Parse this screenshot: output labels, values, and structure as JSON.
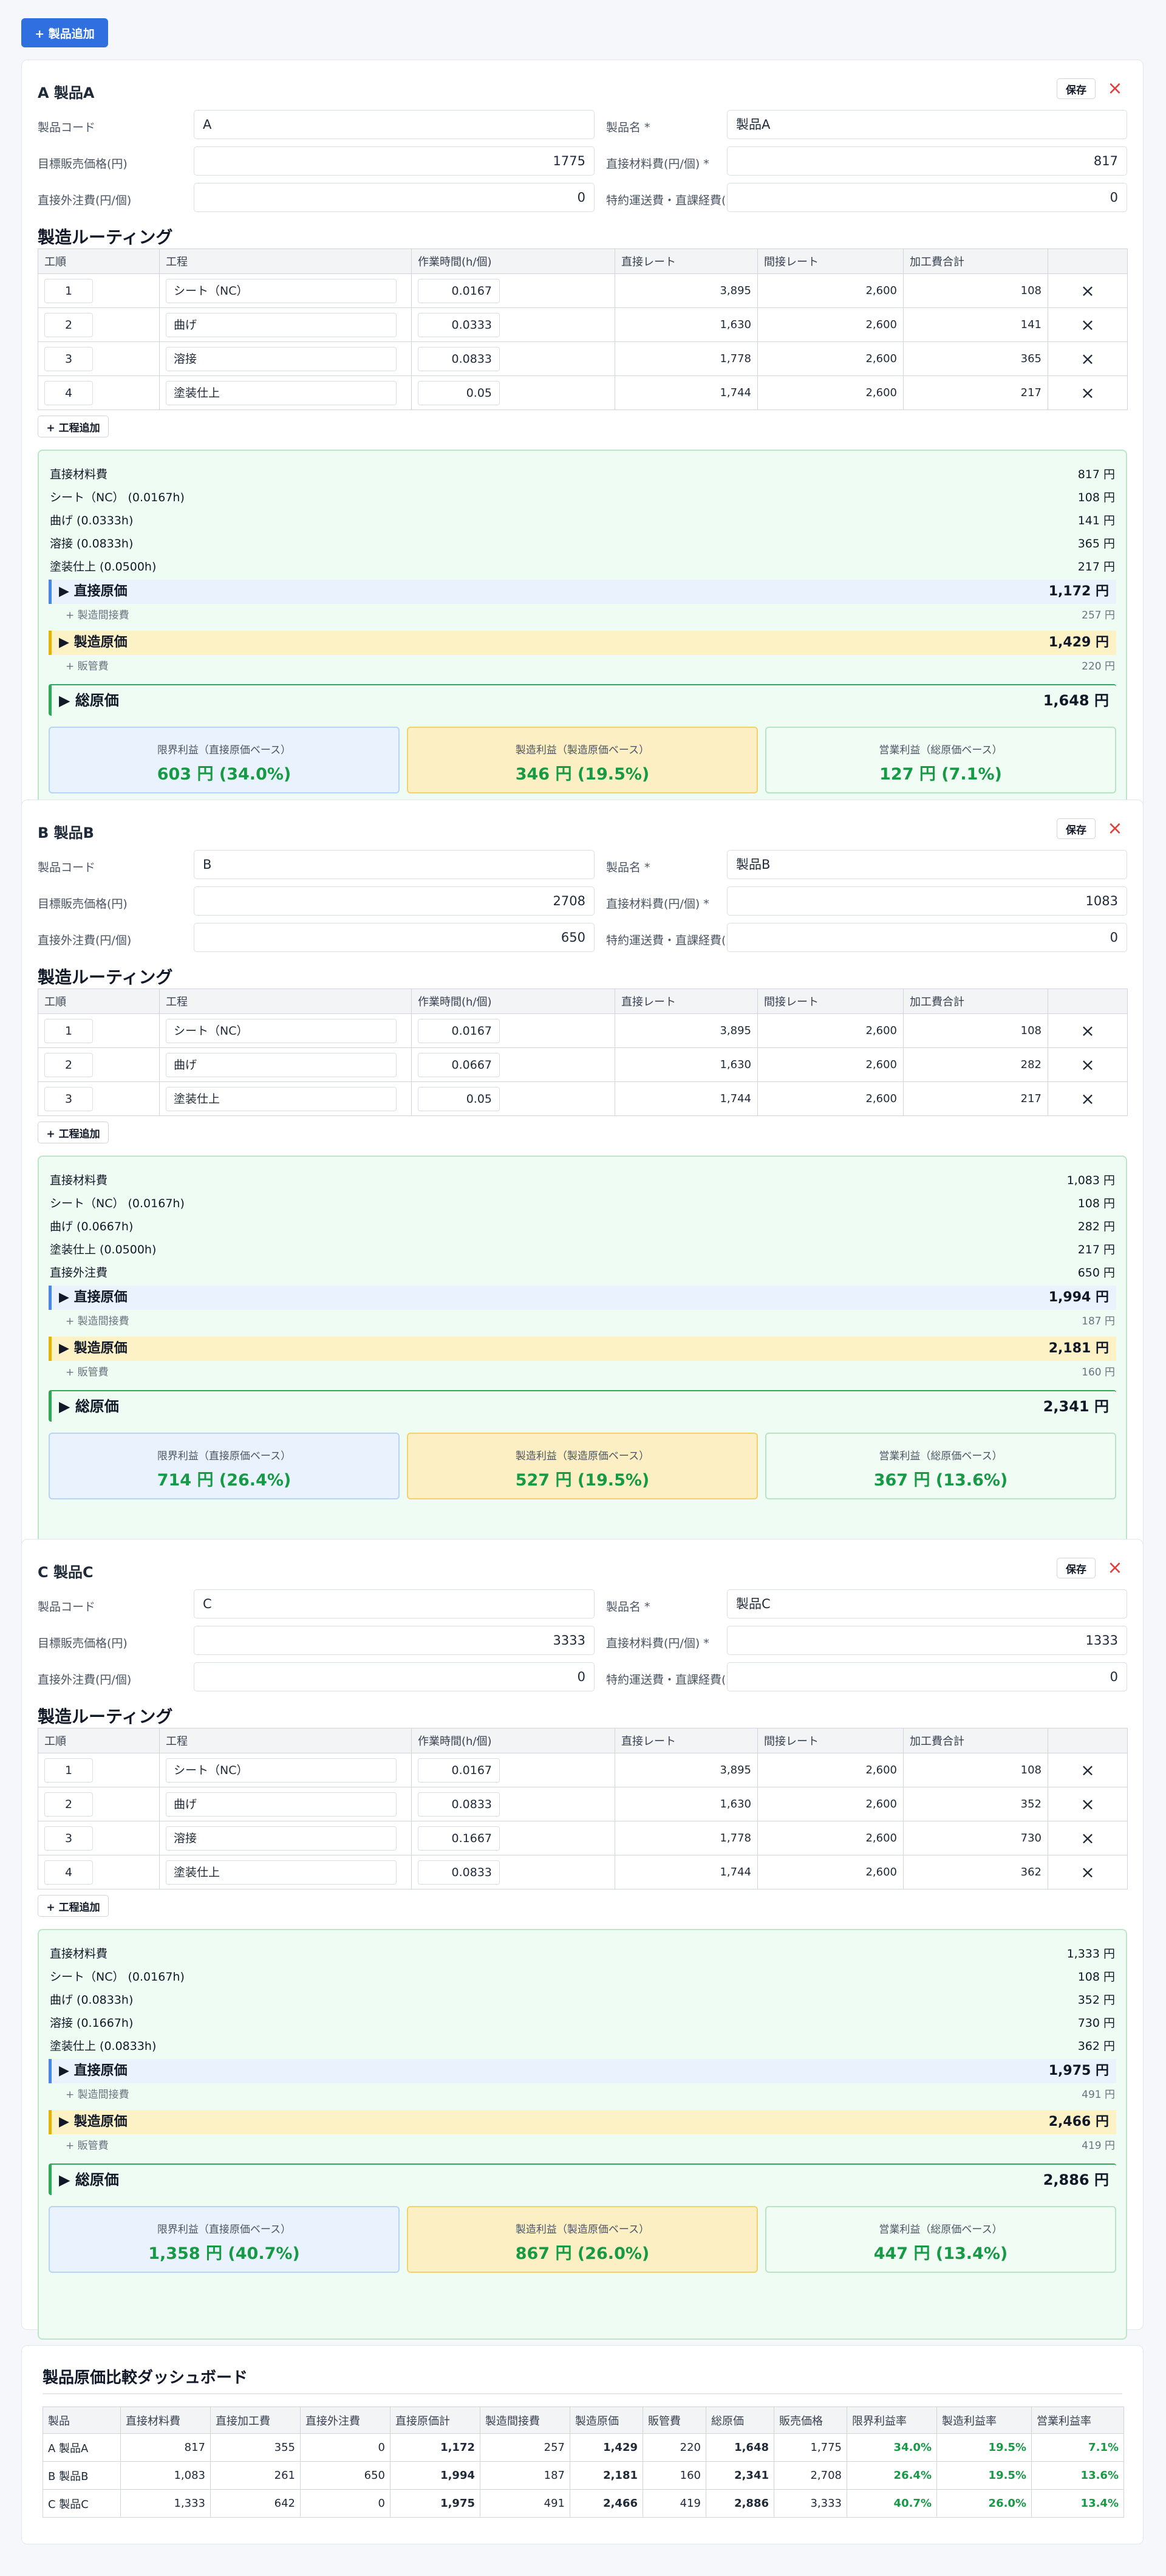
{
  "add_product_label": "+ 製品追加",
  "save_label": "保存",
  "delete_icon": "×",
  "field_labels": {
    "code": "製品コード",
    "name": "製品名 *",
    "target_price": "目標販売価格(円)",
    "material": "直接材料費(円/個) *",
    "outsource": "直接外注費(円/個)",
    "special": "特約運送費・直課経費("
  },
  "routing_title": "製造ルーティング",
  "routing_headers": [
    "工順",
    "工程",
    "作業時間(h/個)",
    "直接レート",
    "間接レート",
    "加工費合計",
    ""
  ],
  "add_process_label": "+ 工程追加",
  "summary_labels": {
    "material": "直接材料費",
    "outsource": "直接外注費",
    "direct_cost": "▶ 直接原価",
    "mfg_indirect": "+ 製造間接費",
    "mfg_cost": "▶ 製造原価",
    "sga": "+ 販管費",
    "total_cost": "▶ 総原価",
    "box1": "限界利益（直接原価ベース）",
    "box2": "製造利益（製造原価ベース）",
    "box3": "営業利益（総原価ベース）"
  },
  "products": [
    {
      "title": "A 製品A",
      "code": "A",
      "name": "製品A",
      "target_price": "1775",
      "material": "817",
      "outsource": "0",
      "special": "0",
      "routing": [
        {
          "seq": "1",
          "process": "シート（NC）",
          "time": "0.0167",
          "direct": "3,895",
          "indirect": "2,600",
          "total": "108"
        },
        {
          "seq": "2",
          "process": "曲げ",
          "time": "0.0333",
          "direct": "1,630",
          "indirect": "2,600",
          "total": "141"
        },
        {
          "seq": "3",
          "process": "溶接",
          "time": "0.0833",
          "direct": "1,778",
          "indirect": "2,600",
          "total": "365"
        },
        {
          "seq": "4",
          "process": "塗装仕上",
          "time": "0.05",
          "direct": "1,744",
          "indirect": "2,600",
          "total": "217"
        }
      ],
      "summary": {
        "material": "817 円",
        "lines": [
          {
            "label": "シート（NC） (0.0167h)",
            "value": "108 円"
          },
          {
            "label": "曲げ (0.0333h)",
            "value": "141 円"
          },
          {
            "label": "溶接 (0.0833h)",
            "value": "365 円"
          },
          {
            "label": "塗装仕上 (0.0500h)",
            "value": "217 円"
          }
        ],
        "outsource": null,
        "direct_cost": "1,172 円",
        "mfg_indirect": "257 円",
        "mfg_cost": "1,429 円",
        "sga": "220 円",
        "total_cost": "1,648 円",
        "box1": "603 円 (34.0%)",
        "box2": "346 円 (19.5%)",
        "box3": "127 円 (7.1%)"
      }
    },
    {
      "title": "B 製品B",
      "code": "B",
      "name": "製品B",
      "target_price": "2708",
      "material": "1083",
      "outsource": "650",
      "special": "0",
      "routing": [
        {
          "seq": "1",
          "process": "シート（NC）",
          "time": "0.0167",
          "direct": "3,895",
          "indirect": "2,600",
          "total": "108"
        },
        {
          "seq": "2",
          "process": "曲げ",
          "time": "0.0667",
          "direct": "1,630",
          "indirect": "2,600",
          "total": "282"
        },
        {
          "seq": "3",
          "process": "塗装仕上",
          "time": "0.05",
          "direct": "1,744",
          "indirect": "2,600",
          "total": "217"
        }
      ],
      "summary": {
        "material": "1,083 円",
        "lines": [
          {
            "label": "シート（NC） (0.0167h)",
            "value": "108 円"
          },
          {
            "label": "曲げ (0.0667h)",
            "value": "282 円"
          },
          {
            "label": "塗装仕上 (0.0500h)",
            "value": "217 円"
          }
        ],
        "outsource": "650 円",
        "direct_cost": "1,994 円",
        "mfg_indirect": "187 円",
        "mfg_cost": "2,181 円",
        "sga": "160 円",
        "total_cost": "2,341 円",
        "box1": "714 円 (26.4%)",
        "box2": "527 円 (19.5%)",
        "box3": "367 円 (13.6%)"
      }
    },
    {
      "title": "C 製品C",
      "code": "C",
      "name": "製品C",
      "target_price": "3333",
      "material": "1333",
      "outsource": "0",
      "special": "0",
      "routing": [
        {
          "seq": "1",
          "process": "シート（NC）",
          "time": "0.0167",
          "direct": "3,895",
          "indirect": "2,600",
          "total": "108"
        },
        {
          "seq": "2",
          "process": "曲げ",
          "time": "0.0833",
          "direct": "1,630",
          "indirect": "2,600",
          "total": "352"
        },
        {
          "seq": "3",
          "process": "溶接",
          "time": "0.1667",
          "direct": "1,778",
          "indirect": "2,600",
          "total": "730"
        },
        {
          "seq": "4",
          "process": "塗装仕上",
          "time": "0.0833",
          "direct": "1,744",
          "indirect": "2,600",
          "total": "362"
        }
      ],
      "summary": {
        "material": "1,333 円",
        "lines": [
          {
            "label": "シート（NC） (0.0167h)",
            "value": "108 円"
          },
          {
            "label": "曲げ (0.0833h)",
            "value": "352 円"
          },
          {
            "label": "溶接 (0.1667h)",
            "value": "730 円"
          },
          {
            "label": "塗装仕上 (0.0833h)",
            "value": "362 円"
          }
        ],
        "outsource": null,
        "direct_cost": "1,975 円",
        "mfg_indirect": "491 円",
        "mfg_cost": "2,466 円",
        "sga": "419 円",
        "total_cost": "2,886 円",
        "box1": "1,358 円 (40.7%)",
        "box2": "867 円 (26.0%)",
        "box3": "447 円 (13.4%)"
      }
    }
  ],
  "dashboard": {
    "title": "製品原価比較ダッシュボード",
    "headers": [
      "製品",
      "直接材料費",
      "直接加工費",
      "直接外注費",
      "直接原価計",
      "製造間接費",
      "製造原価",
      "販管費",
      "総原価",
      "販売価格",
      "限界利益率",
      "製造利益率",
      "営業利益率"
    ],
    "rows": [
      [
        "A 製品A",
        "817",
        "355",
        "0",
        "1,172",
        "257",
        "1,429",
        "220",
        "1,648",
        "1,775",
        "34.0%",
        "19.5%",
        "7.1%"
      ],
      [
        "B 製品B",
        "1,083",
        "261",
        "650",
        "1,994",
        "187",
        "2,181",
        "160",
        "2,341",
        "2,708",
        "26.4%",
        "19.5%",
        "13.6%"
      ],
      [
        "C 製品C",
        "1,333",
        "642",
        "0",
        "1,975",
        "491",
        "2,466",
        "419",
        "2,886",
        "3,333",
        "40.7%",
        "26.0%",
        "13.4%"
      ]
    ]
  }
}
